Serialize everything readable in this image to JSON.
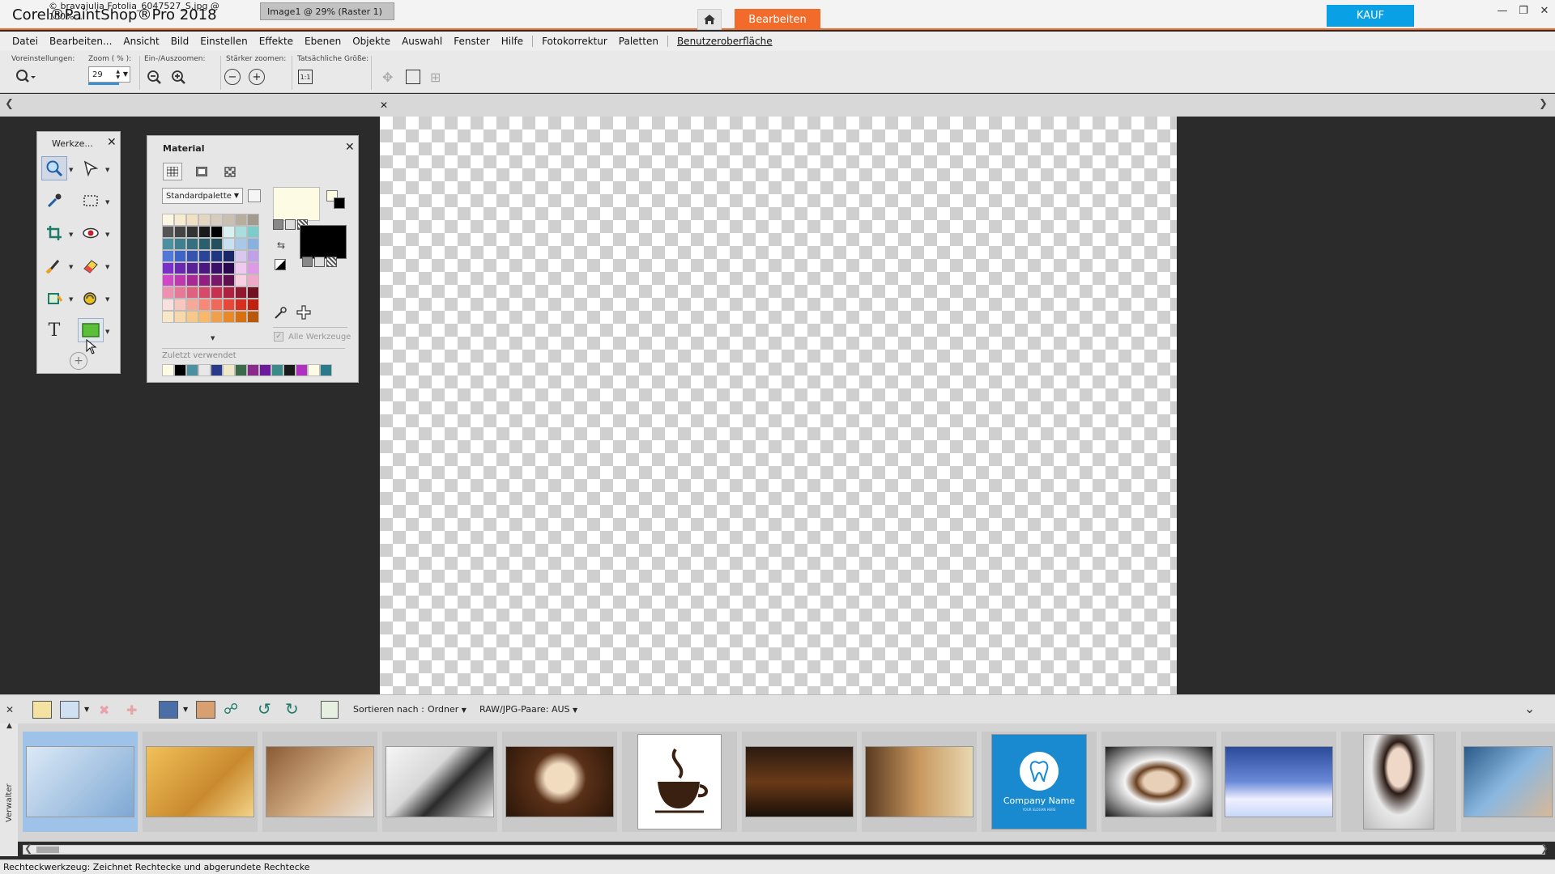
{
  "app": {
    "title": "Corel®PaintShop®Pro 2018",
    "edit_tab": "Bearbeiten",
    "buy": "KAUF"
  },
  "menu": [
    "Datei",
    "Bearbeiten...",
    "Ansicht",
    "Bild",
    "Einstellen",
    "Effekte",
    "Ebenen",
    "Objekte",
    "Auswahl",
    "Fenster",
    "Hilfe",
    "Fotokorrektur",
    "Paletten",
    "Benutzeroberfläche"
  ],
  "toolbar": {
    "presets_label": "Voreinstellungen:",
    "zoom_label": "Zoom ( % ):",
    "zoom_value": "29",
    "zoom_inout_label": "Ein-/Auszoomen:",
    "zoom_more_label": "Stärker zoomen:",
    "actual_size_label": "Tatsächliche Größe:"
  },
  "tabs": [
    {
      "label": "© bravajulia Fotolia_6047527_S.jpg @ 100%..."
    },
    {
      "label": "Image1 @  29% (Raster 1)"
    }
  ],
  "tools_panel": {
    "title": "Werkze..."
  },
  "material_panel": {
    "title": "Material",
    "palette_select": "Standardpalette",
    "all_tools": "Alle Werkzeuge",
    "recent_label": "Zuletzt verwendet",
    "foreground_color": "#fefbe4",
    "background_color": "#000000",
    "swatches": [
      "#fdf6e3",
      "#f7ecd0",
      "#efe1c2",
      "#e4d6c0",
      "#d6ccbe",
      "#c9bfb2",
      "#b7ad9f",
      "#a39a8e",
      "#555555",
      "#444444",
      "#333333",
      "#1a1a1a",
      "#000000",
      "#d8f0f0",
      "#a8dede",
      "#7ccccc",
      "#4b8fa0",
      "#3f7f90",
      "#356f80",
      "#2c5f6e",
      "#244f5c",
      "#c8e0f0",
      "#a8c8e8",
      "#88b0e0",
      "#4f78d8",
      "#3e64c8",
      "#3454b0",
      "#2a4498",
      "#203680",
      "#1a2868",
      "#d8c8f0",
      "#c0a0e8",
      "#7a30c8",
      "#6a28b0",
      "#5a2098",
      "#4a1880",
      "#3a1068",
      "#2a0850",
      "#f0c8f0",
      "#e098e8",
      "#d048c8",
      "#c038b0",
      "#a82898",
      "#902080",
      "#781868",
      "#601050",
      "#f8d0e0",
      "#f0a8c8",
      "#f090b0",
      "#e87898",
      "#e06080",
      "#d84868",
      "#c83050",
      "#b02040",
      "#901830",
      "#701020",
      "#f8e0e0",
      "#f8c8c0",
      "#f8a898",
      "#f88878",
      "#f06858",
      "#e84838",
      "#d83020",
      "#c02010",
      "#f8e8c8",
      "#f8d8a8",
      "#f8c888",
      "#f8b868",
      "#f0a048",
      "#e88828",
      "#d87010",
      "#b85808"
    ],
    "recent": [
      "#fefbe4",
      "#000000",
      "#4b8fa0",
      "#e8e8e8",
      "#2a3a8a",
      "#f0e8c8",
      "#3a6a4a",
      "#8a2a8a",
      "#6a1a9a",
      "#3a8a8a",
      "#1a1a1a",
      "#b030c0",
      "#fefbe4",
      "#2a7a8a"
    ]
  },
  "organizer": {
    "sort_label": "Sortieren nach :",
    "sort_value": "Ordner",
    "raw_jpg_label": "RAW/JPG-Paare: AUS",
    "side_label": "Verwalter",
    "company_name": "Company Name",
    "company_tagline": "YOUR SLOGAN HERE"
  },
  "status": "Rechteckwerkzeug: Zeichnet Rechtecke und abgerundete Rechtecke"
}
